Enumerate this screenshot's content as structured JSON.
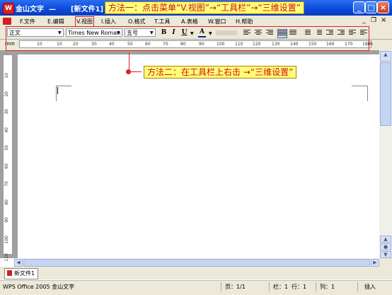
{
  "titlebar": {
    "app_title": "金山文字  —",
    "doc_title": "[新文件1]"
  },
  "callouts": {
    "method1": "方法一：点击菜单“V.视图”→“工具栏”→“三维设置”",
    "method2": "方法二：在工具栏上右击 →“三维设置”"
  },
  "menu": {
    "items": [
      "F.文件",
      "E.编辑",
      "V.视图",
      "I.插入",
      "O.格式",
      "T.工具",
      "A.表格",
      "W.窗口",
      "H.帮助"
    ]
  },
  "toolbar": {
    "style": "正文",
    "font": "Times New Roman",
    "size": "五号",
    "bold": "B",
    "italic": "I",
    "underline": "U",
    "fontcolor": "A"
  },
  "ruler": {
    "unit": "mm",
    "ticks": [
      "10",
      "10",
      "20",
      "30",
      "40",
      "50",
      "60",
      "70",
      "80",
      "90",
      "100",
      "110",
      "120",
      "130",
      "140",
      "150",
      "160",
      "170",
      "180",
      "19"
    ]
  },
  "vruler": {
    "ticks": [
      "10",
      "20",
      "30",
      "40",
      "50",
      "60",
      "70",
      "80",
      "90",
      "100",
      "110",
      "120"
    ]
  },
  "tabs": {
    "doc": "新文件1"
  },
  "status": {
    "app": "WPS Office 2005 金山文字",
    "page": "页：1/1",
    "col_bar": "栏：1",
    "row": "行：1",
    "col": "列：1",
    "mode": "插入"
  },
  "colors": {
    "title_blue": "#0a48d8",
    "callout_bg": "#fefe7a",
    "callout_text": "#d01010",
    "highlight": "#e02020"
  }
}
